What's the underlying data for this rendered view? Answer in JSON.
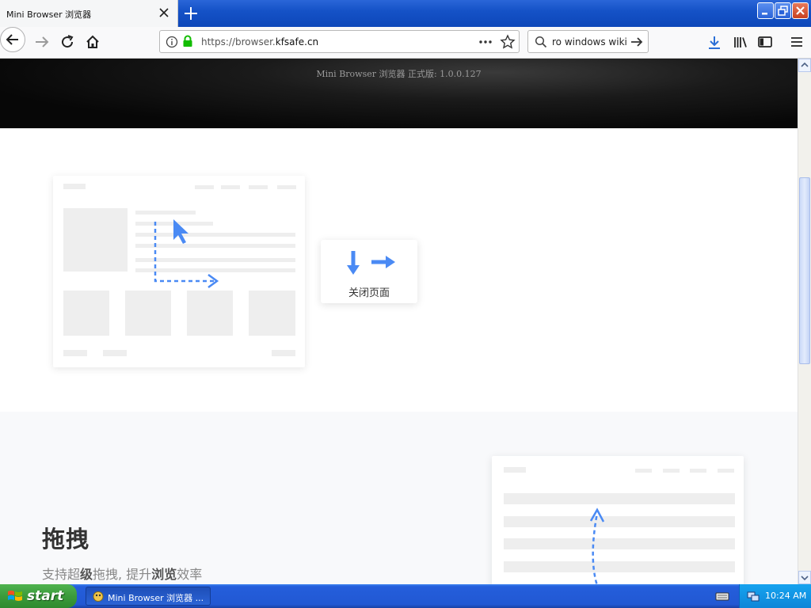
{
  "browser": {
    "tab_title": "Mini Browser 浏览器",
    "url_prefix": "https://browser.",
    "url_domain": "kfsafe.cn",
    "search_text": "ro windows wiki"
  },
  "page": {
    "hero_text": "Mini Browser 浏览器 正式版: 1.0.0.127",
    "card_label": "关闭页面",
    "drag_title": "拖拽",
    "drag_sub_1": "支持超",
    "drag_sub_2": "级",
    "drag_sub_3": "拖拽, 提升",
    "drag_sub_4": "浏览",
    "drag_sub_5": "效率"
  },
  "taskbar": {
    "start_label": "start",
    "task_label": "Mini Browser 浏览器 ...",
    "clock": "10:24 AM"
  },
  "colors": {
    "accent_blue": "#4a8af4",
    "secure_green": "#12bc00",
    "xp_blue": "#245edb",
    "start_green": "#3b9b3b"
  },
  "icons": [
    "close-icon",
    "plus-icon",
    "back-arrow-icon",
    "forward-arrow-icon",
    "reload-icon",
    "home-icon",
    "info-icon",
    "lock-icon",
    "more-icon",
    "star-icon",
    "search-icon",
    "arrow-right-icon",
    "download-icon",
    "library-icon",
    "sidebar-icon",
    "menu-icon",
    "windows-logo-icon",
    "keyboard-icon",
    "network-icon"
  ]
}
